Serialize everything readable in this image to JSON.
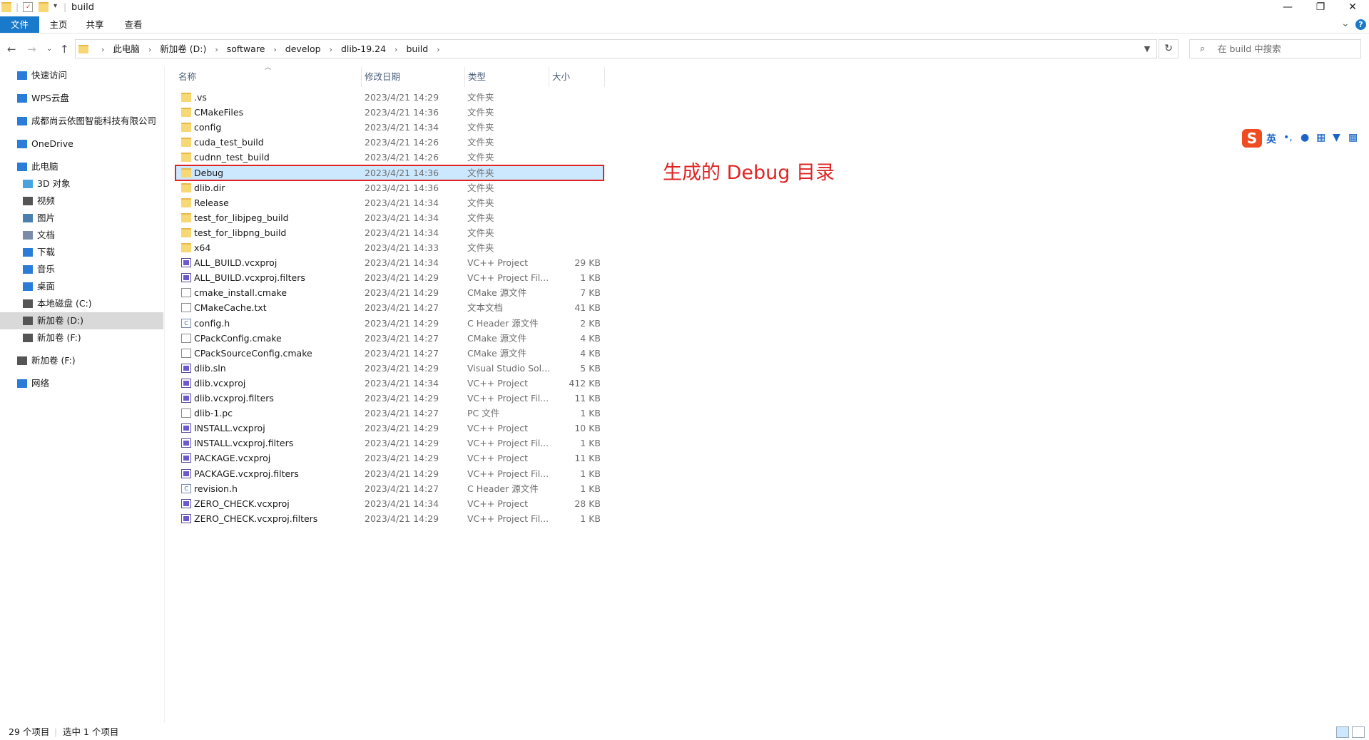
{
  "window": {
    "title": "build",
    "minimize_glyph": "—",
    "restore_glyph": "❐",
    "close_glyph": "✕"
  },
  "ribbon": {
    "tabs": [
      "文件",
      "主页",
      "共享",
      "查看"
    ],
    "expand_glyph": "⌄",
    "help_glyph": "?"
  },
  "address": {
    "crumbs": [
      "此电脑",
      "新加卷 (D:)",
      "software",
      "develop",
      "dlib-19.24",
      "build"
    ],
    "separator": "›"
  },
  "search": {
    "placeholder": "在 build 中搜索"
  },
  "navpane": {
    "items": [
      {
        "label": "快速访问",
        "icon": "star-icon",
        "color": "#2b7bd8"
      },
      {
        "label": "WPS云盘",
        "icon": "cloud-icon",
        "color": "#2b7bd8"
      },
      {
        "label": "成都尚云依图智能科技有限公司",
        "icon": "building-icon",
        "color": "#2b7bd8"
      },
      {
        "label": "OneDrive",
        "icon": "onedrive-icon",
        "color": "#2b7bd8"
      },
      {
        "label": "此电脑",
        "icon": "computer-icon",
        "color": "#2b7bd8"
      },
      {
        "label": "3D 对象",
        "icon": "cube-icon",
        "color": "#4aa3df"
      },
      {
        "label": "视频",
        "icon": "video-icon",
        "color": "#555555"
      },
      {
        "label": "图片",
        "icon": "picture-icon",
        "color": "#4a7fb0"
      },
      {
        "label": "文档",
        "icon": "document-icon",
        "color": "#7a8aa8"
      },
      {
        "label": "下载",
        "icon": "download-icon",
        "color": "#2b7bd8"
      },
      {
        "label": "音乐",
        "icon": "music-icon",
        "color": "#2b7bd8"
      },
      {
        "label": "桌面",
        "icon": "desktop-icon",
        "color": "#2b7bd8"
      },
      {
        "label": "本地磁盘 (C:)",
        "icon": "drive-icon",
        "color": "#555555"
      },
      {
        "label": "新加卷 (D:)",
        "icon": "drive-icon",
        "color": "#555555",
        "selected": true
      },
      {
        "label": "新加卷 (F:)",
        "icon": "drive-icon",
        "color": "#555555"
      },
      {
        "label": "新加卷 (F:)",
        "icon": "drive-icon",
        "color": "#555555"
      },
      {
        "label": "网络",
        "icon": "network-icon",
        "color": "#2b7bd8"
      }
    ]
  },
  "columns": {
    "name": "名称",
    "date": "修改日期",
    "type": "类型",
    "size": "大小"
  },
  "files": [
    {
      "name": ".vs",
      "date": "2023/4/21 14:29",
      "type": "文件夹",
      "size": "",
      "icon": "folder"
    },
    {
      "name": "CMakeFiles",
      "date": "2023/4/21 14:36",
      "type": "文件夹",
      "size": "",
      "icon": "folder"
    },
    {
      "name": "config",
      "date": "2023/4/21 14:34",
      "type": "文件夹",
      "size": "",
      "icon": "folder"
    },
    {
      "name": "cuda_test_build",
      "date": "2023/4/21 14:26",
      "type": "文件夹",
      "size": "",
      "icon": "folder"
    },
    {
      "name": "cudnn_test_build",
      "date": "2023/4/21 14:26",
      "type": "文件夹",
      "size": "",
      "icon": "folder"
    },
    {
      "name": "Debug",
      "date": "2023/4/21 14:36",
      "type": "文件夹",
      "size": "",
      "icon": "folder",
      "selected": true
    },
    {
      "name": "dlib.dir",
      "date": "2023/4/21 14:36",
      "type": "文件夹",
      "size": "",
      "icon": "folder"
    },
    {
      "name": "Release",
      "date": "2023/4/21 14:34",
      "type": "文件夹",
      "size": "",
      "icon": "folder"
    },
    {
      "name": "test_for_libjpeg_build",
      "date": "2023/4/21 14:34",
      "type": "文件夹",
      "size": "",
      "icon": "folder"
    },
    {
      "name": "test_for_libpng_build",
      "date": "2023/4/21 14:34",
      "type": "文件夹",
      "size": "",
      "icon": "folder"
    },
    {
      "name": "x64",
      "date": "2023/4/21 14:33",
      "type": "文件夹",
      "size": "",
      "icon": "folder"
    },
    {
      "name": "ALL_BUILD.vcxproj",
      "date": "2023/4/21 14:34",
      "type": "VC++ Project",
      "size": "29 KB",
      "icon": "project"
    },
    {
      "name": "ALL_BUILD.vcxproj.filters",
      "date": "2023/4/21 14:29",
      "type": "VC++ Project Fil...",
      "size": "1 KB",
      "icon": "project"
    },
    {
      "name": "cmake_install.cmake",
      "date": "2023/4/21 14:29",
      "type": "CMake 源文件",
      "size": "7 KB",
      "icon": "file"
    },
    {
      "name": "CMakeCache.txt",
      "date": "2023/4/21 14:27",
      "type": "文本文档",
      "size": "41 KB",
      "icon": "file"
    },
    {
      "name": "config.h",
      "date": "2023/4/21 14:29",
      "type": "C Header 源文件",
      "size": "2 KB",
      "icon": "header"
    },
    {
      "name": "CPackConfig.cmake",
      "date": "2023/4/21 14:27",
      "type": "CMake 源文件",
      "size": "4 KB",
      "icon": "file"
    },
    {
      "name": "CPackSourceConfig.cmake",
      "date": "2023/4/21 14:27",
      "type": "CMake 源文件",
      "size": "4 KB",
      "icon": "file"
    },
    {
      "name": "dlib.sln",
      "date": "2023/4/21 14:29",
      "type": "Visual Studio Sol...",
      "size": "5 KB",
      "icon": "project"
    },
    {
      "name": "dlib.vcxproj",
      "date": "2023/4/21 14:34",
      "type": "VC++ Project",
      "size": "412 KB",
      "icon": "project"
    },
    {
      "name": "dlib.vcxproj.filters",
      "date": "2023/4/21 14:29",
      "type": "VC++ Project Fil...",
      "size": "11 KB",
      "icon": "project"
    },
    {
      "name": "dlib-1.pc",
      "date": "2023/4/21 14:27",
      "type": "PC 文件",
      "size": "1 KB",
      "icon": "file"
    },
    {
      "name": "INSTALL.vcxproj",
      "date": "2023/4/21 14:29",
      "type": "VC++ Project",
      "size": "10 KB",
      "icon": "project"
    },
    {
      "name": "INSTALL.vcxproj.filters",
      "date": "2023/4/21 14:29",
      "type": "VC++ Project Fil...",
      "size": "1 KB",
      "icon": "project"
    },
    {
      "name": "PACKAGE.vcxproj",
      "date": "2023/4/21 14:29",
      "type": "VC++ Project",
      "size": "11 KB",
      "icon": "project"
    },
    {
      "name": "PACKAGE.vcxproj.filters",
      "date": "2023/4/21 14:29",
      "type": "VC++ Project Fil...",
      "size": "1 KB",
      "icon": "project"
    },
    {
      "name": "revision.h",
      "date": "2023/4/21 14:27",
      "type": "C Header 源文件",
      "size": "1 KB",
      "icon": "header"
    },
    {
      "name": "ZERO_CHECK.vcxproj",
      "date": "2023/4/21 14:34",
      "type": "VC++ Project",
      "size": "28 KB",
      "icon": "project"
    },
    {
      "name": "ZERO_CHECK.vcxproj.filters",
      "date": "2023/4/21 14:29",
      "type": "VC++ Project Fil...",
      "size": "1 KB",
      "icon": "project"
    }
  ],
  "annotation": "生成的 Debug 目录",
  "ime": {
    "logo": "S",
    "lang": "英",
    "punct": "•,",
    "icons": [
      "microphone-icon",
      "keyboard-icon",
      "skin-icon",
      "toolbox-icon"
    ]
  },
  "status": {
    "count": "29 个项目",
    "selection": "选中 1 个项目"
  },
  "colors": {
    "accent": "#1979ca",
    "selection": "#cce8ff",
    "highlight_box": "#e02424",
    "folder": "#f8d775"
  }
}
